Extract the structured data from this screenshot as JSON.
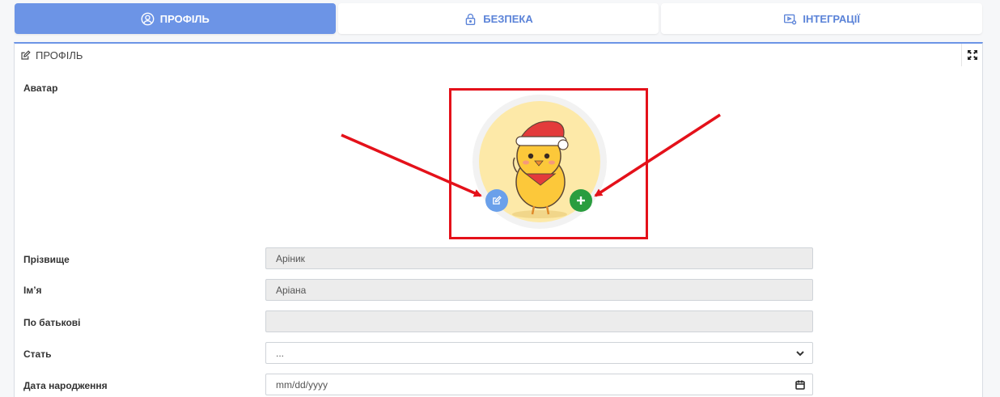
{
  "tabs": [
    {
      "label": "ПРОФІЛЬ",
      "icon": "user-circle-icon",
      "active": true
    },
    {
      "label": "БЕЗПЕКА",
      "icon": "lock-icon",
      "active": false
    },
    {
      "label": "ІНТЕГРАЦІЇ",
      "icon": "video-settings-icon",
      "active": false
    }
  ],
  "panel": {
    "title": "ПРОФІЛЬ"
  },
  "form": {
    "avatar_label": "Аватар",
    "surname_label": "Прізвище",
    "surname_value": "Аріник",
    "name_label": "Ім’я",
    "name_value": "Аріана",
    "patronymic_label": "По батькові",
    "patronymic_value": "",
    "gender_label": "Стать",
    "gender_value": "...",
    "birth_label": "Дата народження",
    "birth_placeholder": "mm/dd/yyyy"
  },
  "colors": {
    "accent": "#6c94e6",
    "edit_button": "#6aa0ea",
    "add_button": "#2a9d3f",
    "annotation": "#e4111a"
  }
}
